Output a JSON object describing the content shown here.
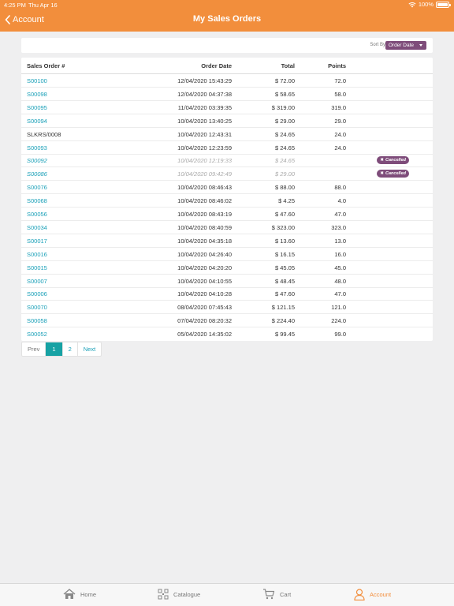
{
  "status": {
    "time": "4:25 PM",
    "date": "Thu Apr 16",
    "battery": "100%"
  },
  "nav": {
    "back_label": "Account",
    "title": "My Sales Orders"
  },
  "sort": {
    "label": "Sort By",
    "value": "Order Date"
  },
  "table": {
    "headers": {
      "order": "Sales Order #",
      "date": "Order Date",
      "total": "Total",
      "points": "Points"
    },
    "rows": [
      {
        "order": "S00100",
        "date": "12/04/2020  15:43:29",
        "total": "$ 72.00",
        "points": "72.0",
        "link": true,
        "status": ""
      },
      {
        "order": "S00098",
        "date": "12/04/2020  04:37:38",
        "total": "$ 58.65",
        "points": "58.0",
        "link": true,
        "status": ""
      },
      {
        "order": "S00095",
        "date": "11/04/2020  03:39:35",
        "total": "$ 319.00",
        "points": "319.0",
        "link": true,
        "status": ""
      },
      {
        "order": "S00094",
        "date": "10/04/2020  13:40:25",
        "total": "$ 29.00",
        "points": "29.0",
        "link": true,
        "status": ""
      },
      {
        "order": "SLKRS/0008",
        "date": "10/04/2020  12:43:31",
        "total": "$ 24.65",
        "points": "24.0",
        "link": false,
        "status": ""
      },
      {
        "order": "S00093",
        "date": "10/04/2020  12:23:59",
        "total": "$ 24.65",
        "points": "24.0",
        "link": true,
        "status": ""
      },
      {
        "order": "S00092",
        "date": "10/04/2020  12:19:33",
        "total": "$ 24.65",
        "points": "",
        "link": true,
        "status": "Cancelled"
      },
      {
        "order": "S00086",
        "date": "10/04/2020  09:42:49",
        "total": "$ 29.00",
        "points": "",
        "link": true,
        "status": "Cancelled"
      },
      {
        "order": "S00076",
        "date": "10/04/2020  08:46:43",
        "total": "$ 88.00",
        "points": "88.0",
        "link": true,
        "status": ""
      },
      {
        "order": "S00068",
        "date": "10/04/2020  08:46:02",
        "total": "$ 4.25",
        "points": "4.0",
        "link": true,
        "status": ""
      },
      {
        "order": "S00056",
        "date": "10/04/2020  08:43:19",
        "total": "$ 47.60",
        "points": "47.0",
        "link": true,
        "status": ""
      },
      {
        "order": "S00034",
        "date": "10/04/2020  08:40:59",
        "total": "$ 323.00",
        "points": "323.0",
        "link": true,
        "status": ""
      },
      {
        "order": "S00017",
        "date": "10/04/2020  04:35:18",
        "total": "$ 13.60",
        "points": "13.0",
        "link": true,
        "status": ""
      },
      {
        "order": "S00016",
        "date": "10/04/2020  04:26:40",
        "total": "$ 16.15",
        "points": "16.0",
        "link": true,
        "status": ""
      },
      {
        "order": "S00015",
        "date": "10/04/2020  04:20:20",
        "total": "$ 45.05",
        "points": "45.0",
        "link": true,
        "status": ""
      },
      {
        "order": "S00007",
        "date": "10/04/2020  04:10:55",
        "total": "$ 48.45",
        "points": "48.0",
        "link": true,
        "status": ""
      },
      {
        "order": "S00006",
        "date": "10/04/2020  04:10:28",
        "total": "$ 47.60",
        "points": "47.0",
        "link": true,
        "status": ""
      },
      {
        "order": "S00070",
        "date": "08/04/2020  07:45:43",
        "total": "$ 121.15",
        "points": "121.0",
        "link": true,
        "status": ""
      },
      {
        "order": "S00058",
        "date": "07/04/2020  08:20:32",
        "total": "$ 224.40",
        "points": "224.0",
        "link": true,
        "status": ""
      },
      {
        "order": "S00052",
        "date": "05/04/2020  14:35:02",
        "total": "$ 99.45",
        "points": "99.0",
        "link": true,
        "status": ""
      }
    ]
  },
  "pagination": {
    "prev": "Prev",
    "pages": [
      "1",
      "2"
    ],
    "current": "1",
    "next": "Next"
  },
  "tabbar": {
    "home": "Home",
    "catalogue": "Catalogue",
    "cart": "Cart",
    "account": "Account"
  },
  "colors": {
    "brand": "#f28e3c",
    "link": "#1aa0b8",
    "badge": "#7e4c7a",
    "active_page": "#17a2a4"
  }
}
